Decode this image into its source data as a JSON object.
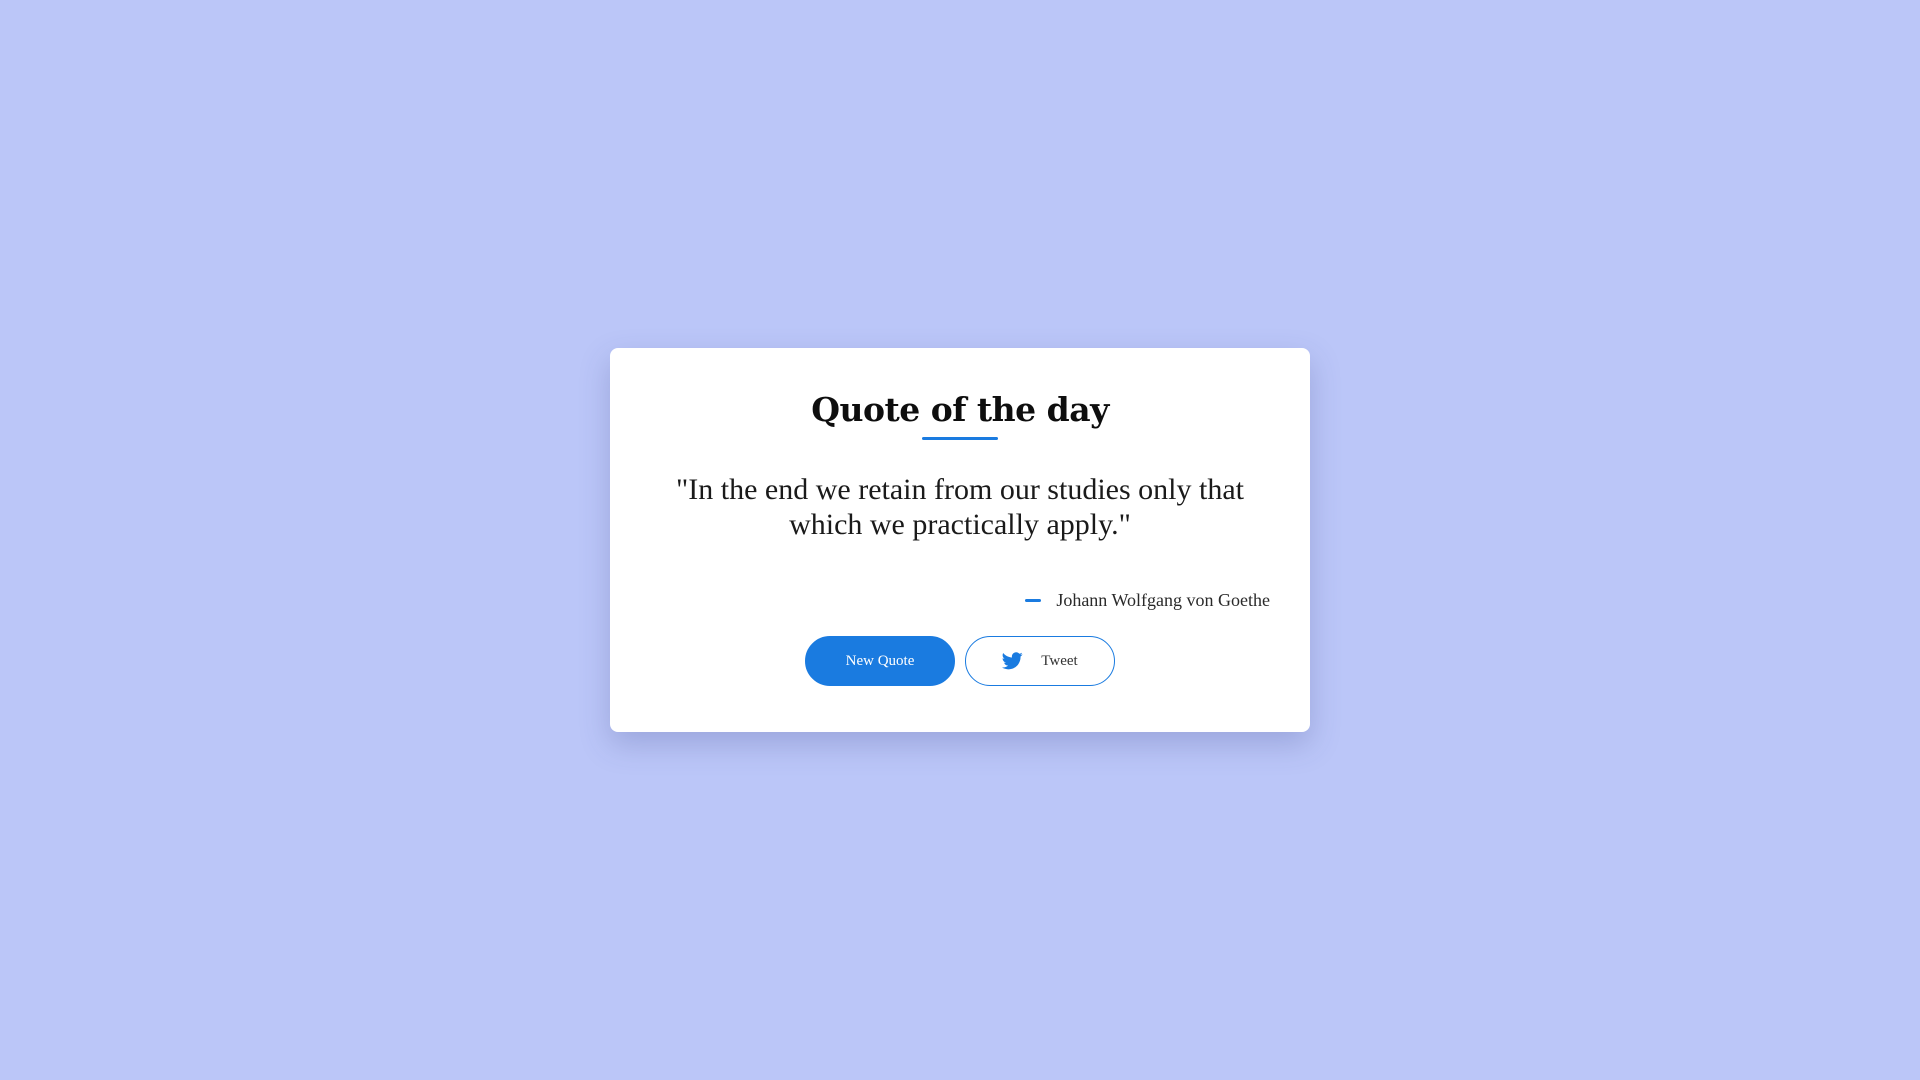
{
  "card": {
    "title": "Quote of the day",
    "quote": "\"In the end we retain from our studies only that which we practically apply.\"",
    "author": "Johann Wolfgang von Goethe"
  },
  "actions": {
    "new_quote_label": "New Quote",
    "tweet_label": "Tweet",
    "tweet_icon": "twitter-icon"
  },
  "colors": {
    "background": "#bbc6f8",
    "accent": "#1a7be0",
    "card": "#ffffff"
  }
}
